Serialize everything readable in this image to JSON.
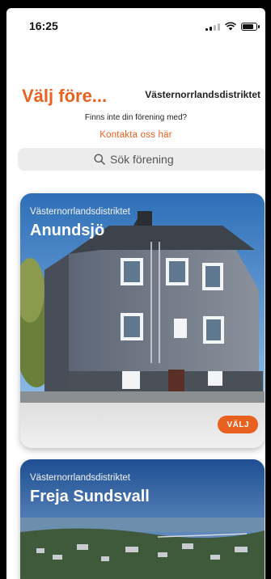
{
  "status_bar": {
    "time": "16:25"
  },
  "header": {
    "title": "Välj före...",
    "district_selected": "Västernorrlandsdistriktet"
  },
  "info": {
    "missing_text": "Finns inte din förening med?",
    "contact_link": "Kontakta oss här"
  },
  "search": {
    "placeholder": "Sök förening"
  },
  "clubs": [
    {
      "district": "Västernorrlandsdistriktet",
      "name": "Anundsjö",
      "choose_label": "VÄLJ"
    },
    {
      "district": "Västernorrlandsdistriktet",
      "name": "Freja Sundsvall"
    }
  ],
  "colors": {
    "accent": "#e8611f",
    "search_bg": "#ececec"
  }
}
